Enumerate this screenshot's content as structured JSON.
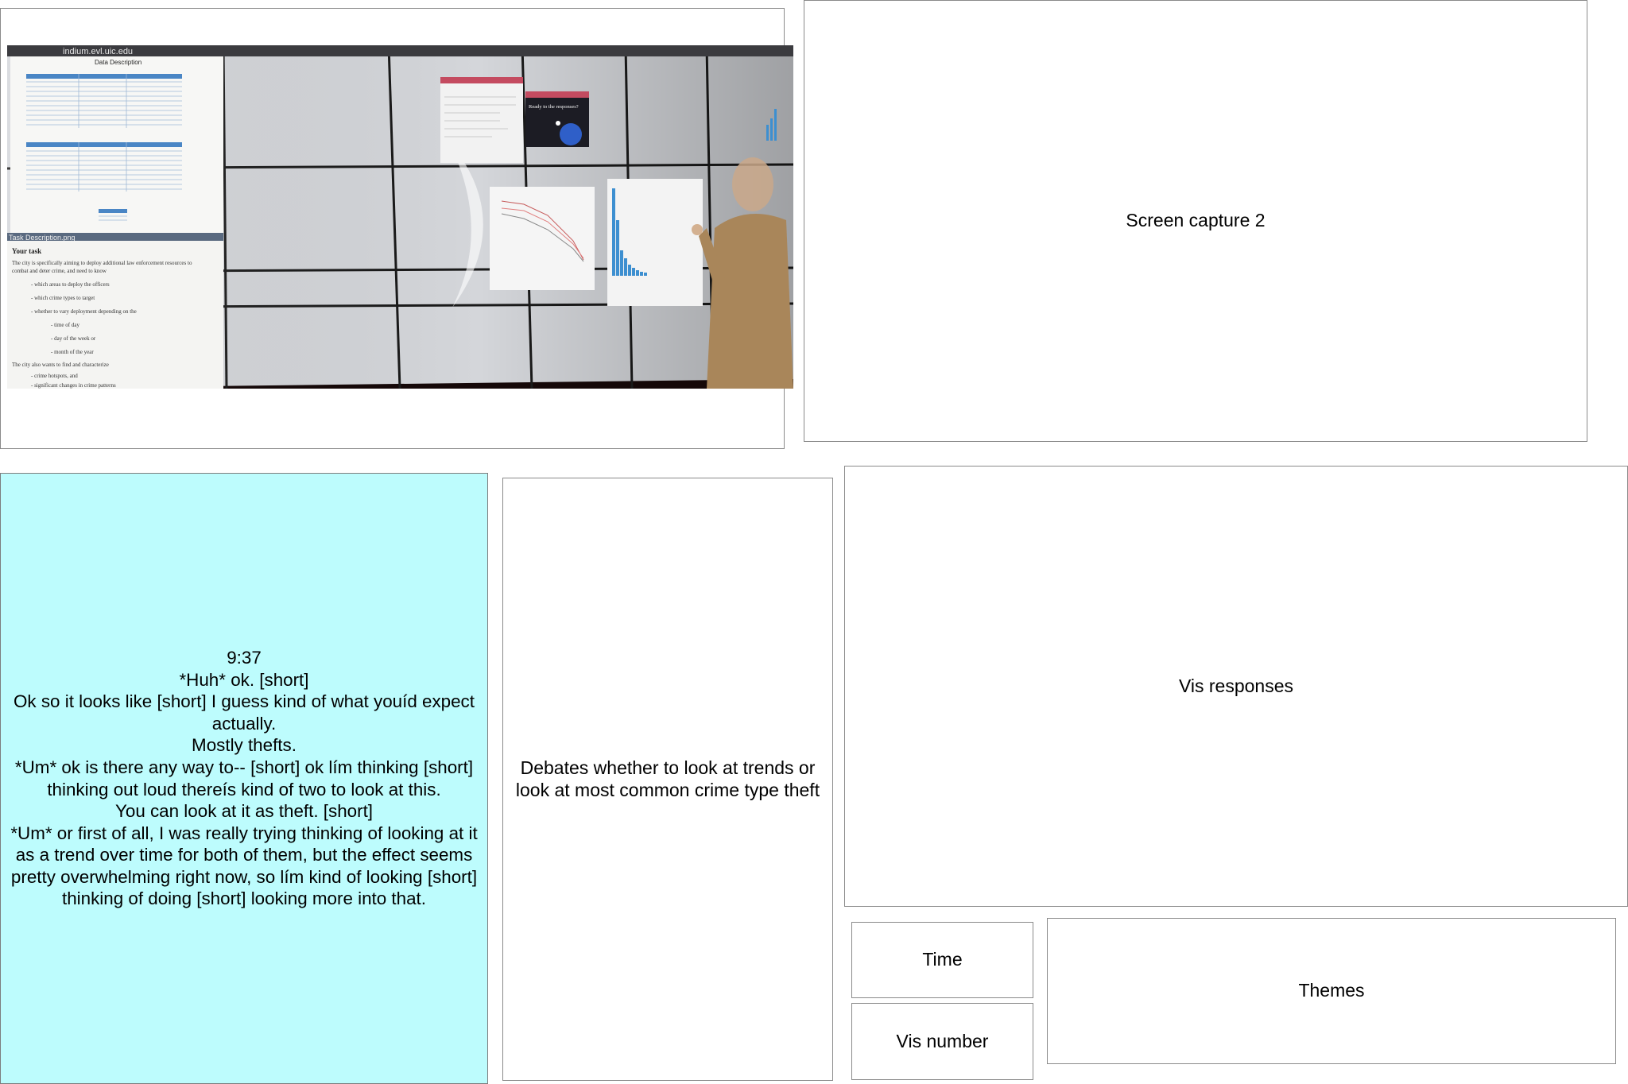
{
  "screen_capture_1": {
    "photo_texts": {
      "window_title": "indium.evl.uic.edu",
      "data_description_title": "Data Description",
      "task_description_file": "Task Description.png",
      "your_task_heading": "Your task",
      "task_lines": [
        "The city is specifically aiming to deploy additional law enforcement resources to",
        "combat and deter crime, and need to know",
        "- which areas to deploy the officers",
        "- which crime types to target",
        "- whether to vary deployment depending on the",
        "- time of day",
        "- day of the week or",
        "- month of the year",
        "The city also wants to find and characterize",
        "- crime hotspots, and",
        "- significant changes in crime patterns"
      ],
      "popup_question": "Ready to the responses?"
    }
  },
  "screen_capture_2": {
    "label": "Screen capture 2"
  },
  "transcript": {
    "lines": [
      "9:37",
      "*Huh* ok. [short]",
      "Ok so it looks like [short] I guess kind of what youíd expect actually.",
      "Mostly thefts.",
      "*Um* ok is there any way to-- [short] ok lím thinking [short] thinking out loud thereís kind of two to look at this.",
      "You can look at it as theft. [short]",
      "*Um* or first of all, I was really trying thinking of looking at it as a trend over time for both of them, but the effect seems pretty overwhelming right now, so lím kind of looking [short] thinking of doing [short] looking more into that."
    ]
  },
  "summary": {
    "text": "Debates whether to look at trends or look at most common crime type theft"
  },
  "vis_responses": {
    "label": "Vis responses"
  },
  "time_box": {
    "label": "Time"
  },
  "vis_number_box": {
    "label": "Vis number"
  },
  "themes_box": {
    "label": "Themes"
  },
  "colors": {
    "transcript_bg": "#bdfcfd",
    "border": "#8a8a8a",
    "wall_panel": "#d7d9dd",
    "table_header": "#4a86c5",
    "chart_bar": "#3d8fd0"
  }
}
